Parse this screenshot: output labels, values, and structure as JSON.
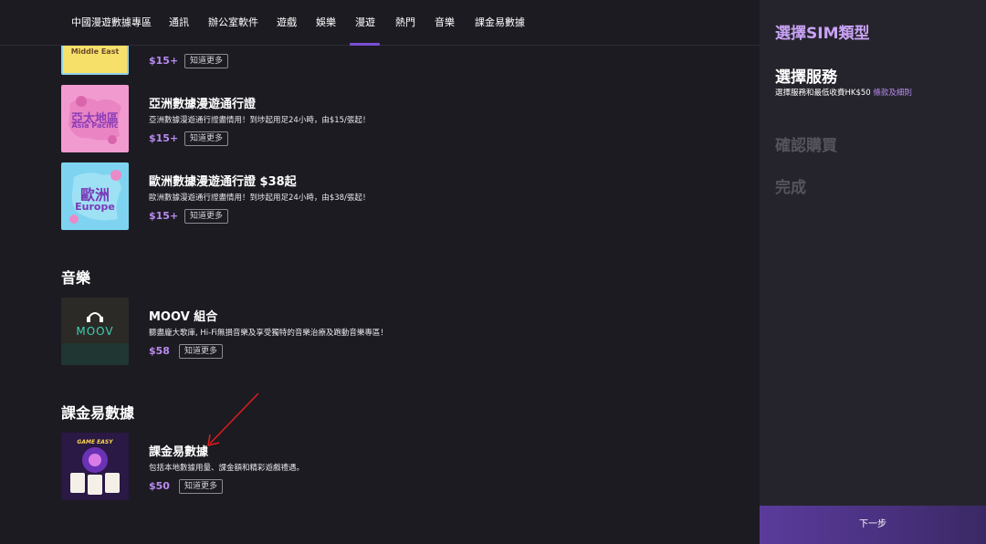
{
  "nav": {
    "items": [
      "中國漫遊數據專區",
      "通訊",
      "辦公室軟件",
      "遊戲",
      "娛樂",
      "漫遊",
      "熱門",
      "音樂",
      "課金易數據"
    ],
    "active": "漫遊"
  },
  "products": {
    "middle_east": {
      "thumb_text": "Middle East",
      "price": "$15+",
      "more": "知道更多"
    },
    "asia": {
      "thumb_text_zh": "亞太地區",
      "thumb_text_en": "Asia Pacific",
      "title": "亞洲數據漫遊通行證",
      "desc": "亞洲數據漫遊通行證盡情用！到埗起用足24小時，由$15/張起！",
      "price": "$15+",
      "more": "知道更多"
    },
    "europe": {
      "thumb_text_zh": "歐洲",
      "thumb_text_en": "Europe",
      "title": "歐洲數據漫遊通行證 $38起",
      "desc": "歐洲數據漫遊通行證盡情用！到埗起用足24小時，由$38/張起！",
      "price": "$15+",
      "more": "知道更多"
    }
  },
  "music": {
    "section_title": "音樂",
    "moov": {
      "thumb_text": "MOOV",
      "title": "MOOV 組合",
      "desc": "聽盡龐大歌庫, Hi-Fi無損音樂及享受獨特的音樂治療及跑動音樂專區！",
      "price": "$58",
      "more": "知道更多"
    }
  },
  "game": {
    "section_title": "課金易數據",
    "item": {
      "thumb_text": "GAME EASY",
      "title": "課金易數據",
      "desc": "包括本地數據用量、課金額和精彩遊戲禮遇。",
      "price": "$50",
      "more": "知道更多"
    }
  },
  "sidebar": {
    "step1": "選擇SIM類型",
    "step2": "選擇服務",
    "step2_sub": "選擇服務和最低收費HK$50",
    "terms_link": "條款及細則",
    "step3": "確認購買",
    "step4": "完成",
    "next_button": "下一步",
    "colors": {
      "accent": "#b98bf0",
      "active_step": "#c9a3f5",
      "inactive_step": "#55545c"
    }
  }
}
